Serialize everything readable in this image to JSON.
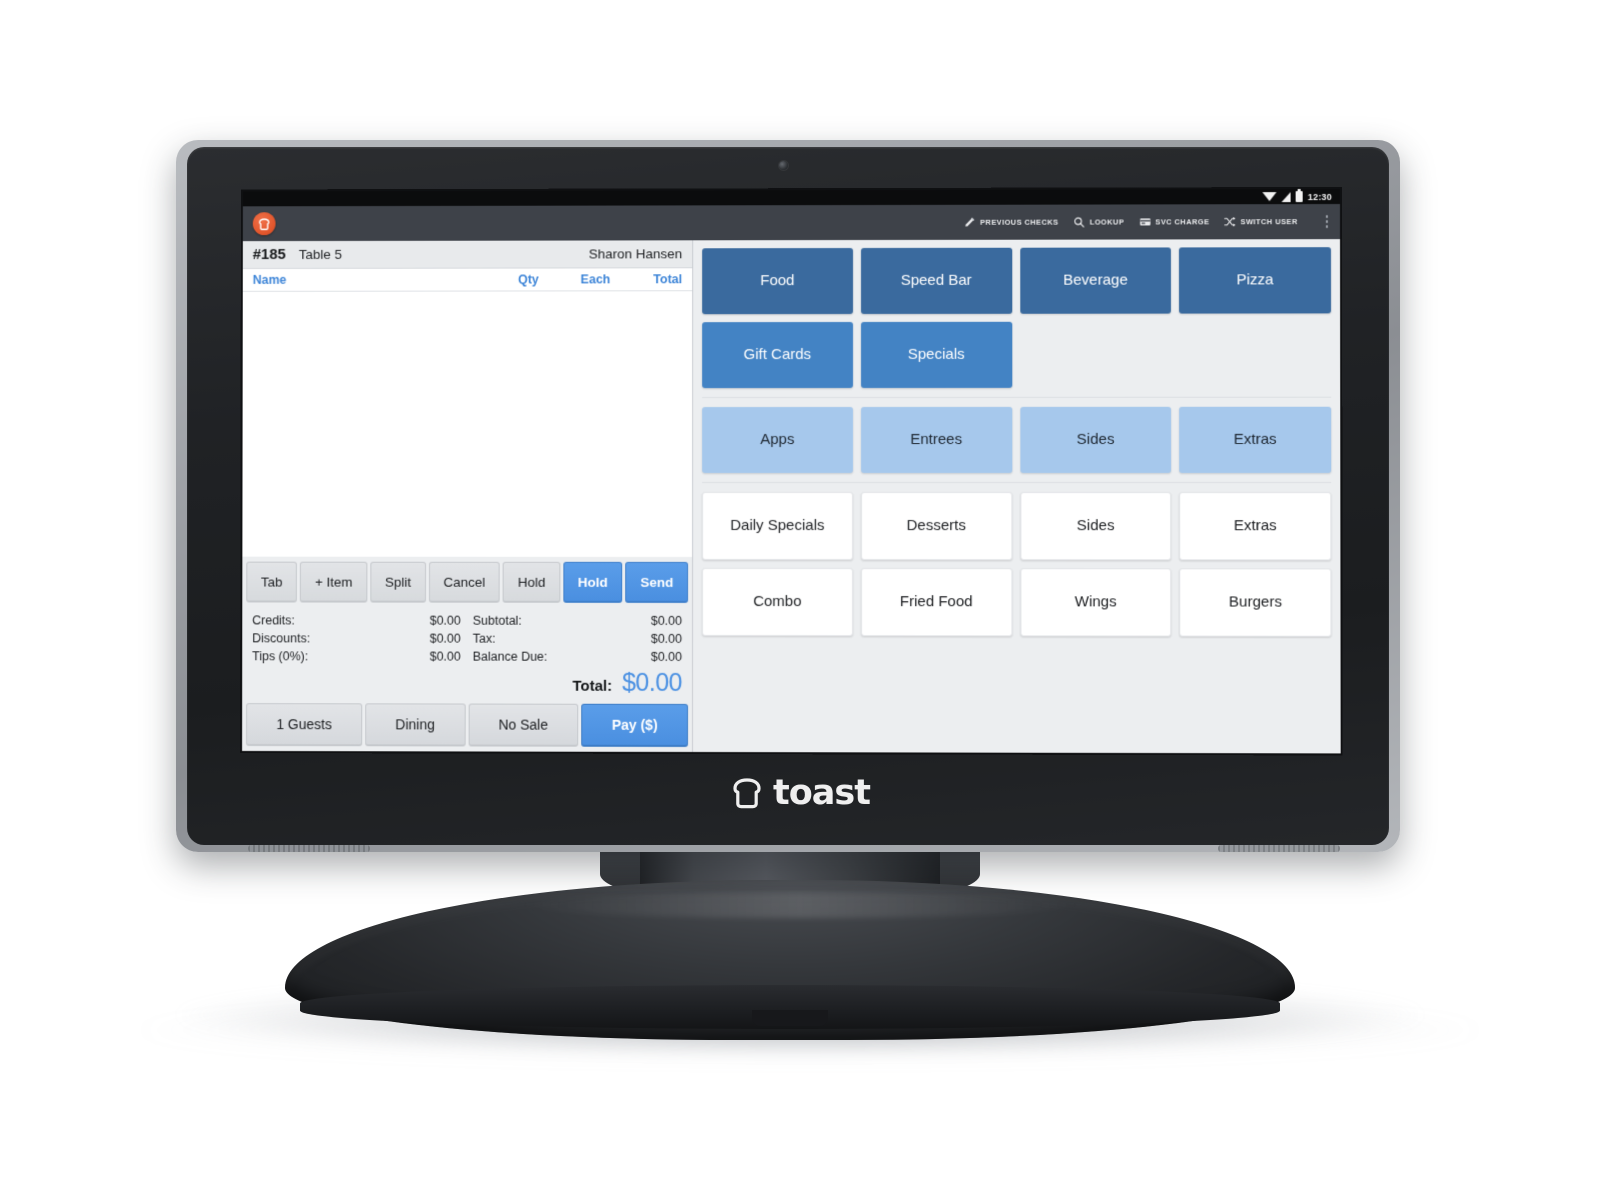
{
  "device": {
    "brand_name": "toast",
    "brand_mark_icon": "toast-bread-logo-icon"
  },
  "status_bar": {
    "clock": "12:30",
    "icons": [
      "wifi-icon",
      "cell-signal-icon",
      "battery-icon"
    ]
  },
  "toolbar": {
    "app_icon": "toast-app-icon",
    "actions": [
      {
        "label": "PREVIOUS CHECKS",
        "icon": "pencil-icon"
      },
      {
        "label": "LOOKUP",
        "icon": "search-icon"
      },
      {
        "label": "SVC CHARGE",
        "icon": "card-swipe-icon"
      },
      {
        "label": "SWITCH USER",
        "icon": "shuffle-arrows-icon"
      }
    ],
    "overflow_icon": "overflow-menu-icon"
  },
  "check": {
    "number": "#185",
    "table": "Table 5",
    "server": "Sharon Hansen",
    "columns": {
      "name": "Name",
      "qty": "Qty",
      "each": "Each",
      "total": "Total"
    },
    "items": [],
    "actions": [
      {
        "label": "Tab",
        "style": "gray"
      },
      {
        "label": "+ Item",
        "style": "gray"
      },
      {
        "label": "Split",
        "style": "gray"
      },
      {
        "label": "Cancel",
        "style": "gray"
      },
      {
        "label": "Hold",
        "style": "gray"
      },
      {
        "label": "Hold",
        "style": "blue"
      },
      {
        "label": "Send",
        "style": "blue"
      }
    ],
    "totals_left": [
      {
        "label": "Credits:",
        "value": "$0.00"
      },
      {
        "label": "Discounts:",
        "value": "$0.00"
      },
      {
        "label": "Tips (0%):",
        "value": "$0.00"
      }
    ],
    "totals_right": [
      {
        "label": "Subtotal:",
        "value": "$0.00"
      },
      {
        "label": "Tax:",
        "value": "$0.00"
      },
      {
        "label": "Balance Due:",
        "value": "$0.00"
      }
    ],
    "grand_total_label": "Total:",
    "grand_total_value": "$0.00",
    "bottom_actions": [
      {
        "label": "1 Guests",
        "style": "gray"
      },
      {
        "label": "Dining",
        "style": "gray"
      },
      {
        "label": "No Sale",
        "style": "gray"
      },
      {
        "label": "Pay ($)",
        "style": "blue"
      }
    ]
  },
  "menu": {
    "groups": [
      {
        "name": "top-categories",
        "buttons": [
          {
            "label": "Food",
            "style": "dark"
          },
          {
            "label": "Speed Bar",
            "style": "dark"
          },
          {
            "label": "Beverage",
            "style": "dark"
          },
          {
            "label": "Pizza",
            "style": "dark"
          },
          {
            "label": "Gift Cards",
            "style": "mid"
          },
          {
            "label": "Specials",
            "style": "mid"
          },
          {
            "label": "",
            "style": "empty"
          },
          {
            "label": "",
            "style": "empty"
          }
        ]
      },
      {
        "name": "subcategories",
        "buttons": [
          {
            "label": "Apps",
            "style": "light"
          },
          {
            "label": "Entrees",
            "style": "light"
          },
          {
            "label": "Sides",
            "style": "light"
          },
          {
            "label": "Extras",
            "style": "light"
          }
        ]
      },
      {
        "name": "items",
        "buttons": [
          {
            "label": "Daily Specials",
            "style": "white"
          },
          {
            "label": "Desserts",
            "style": "white"
          },
          {
            "label": "Sides",
            "style": "white"
          },
          {
            "label": "Extras",
            "style": "white"
          },
          {
            "label": "Combo",
            "style": "white"
          },
          {
            "label": "Fried Food",
            "style": "white"
          },
          {
            "label": "Wings",
            "style": "white"
          },
          {
            "label": "Burgers",
            "style": "white"
          }
        ]
      }
    ]
  },
  "colors": {
    "accent_blue": "#4a90e2",
    "category_dark": "#3a6a9e",
    "category_mid": "#4383c4",
    "category_light": "#a6c8ec",
    "brand_orange": "#e2562c",
    "toolbar_dark": "#3e4249"
  }
}
